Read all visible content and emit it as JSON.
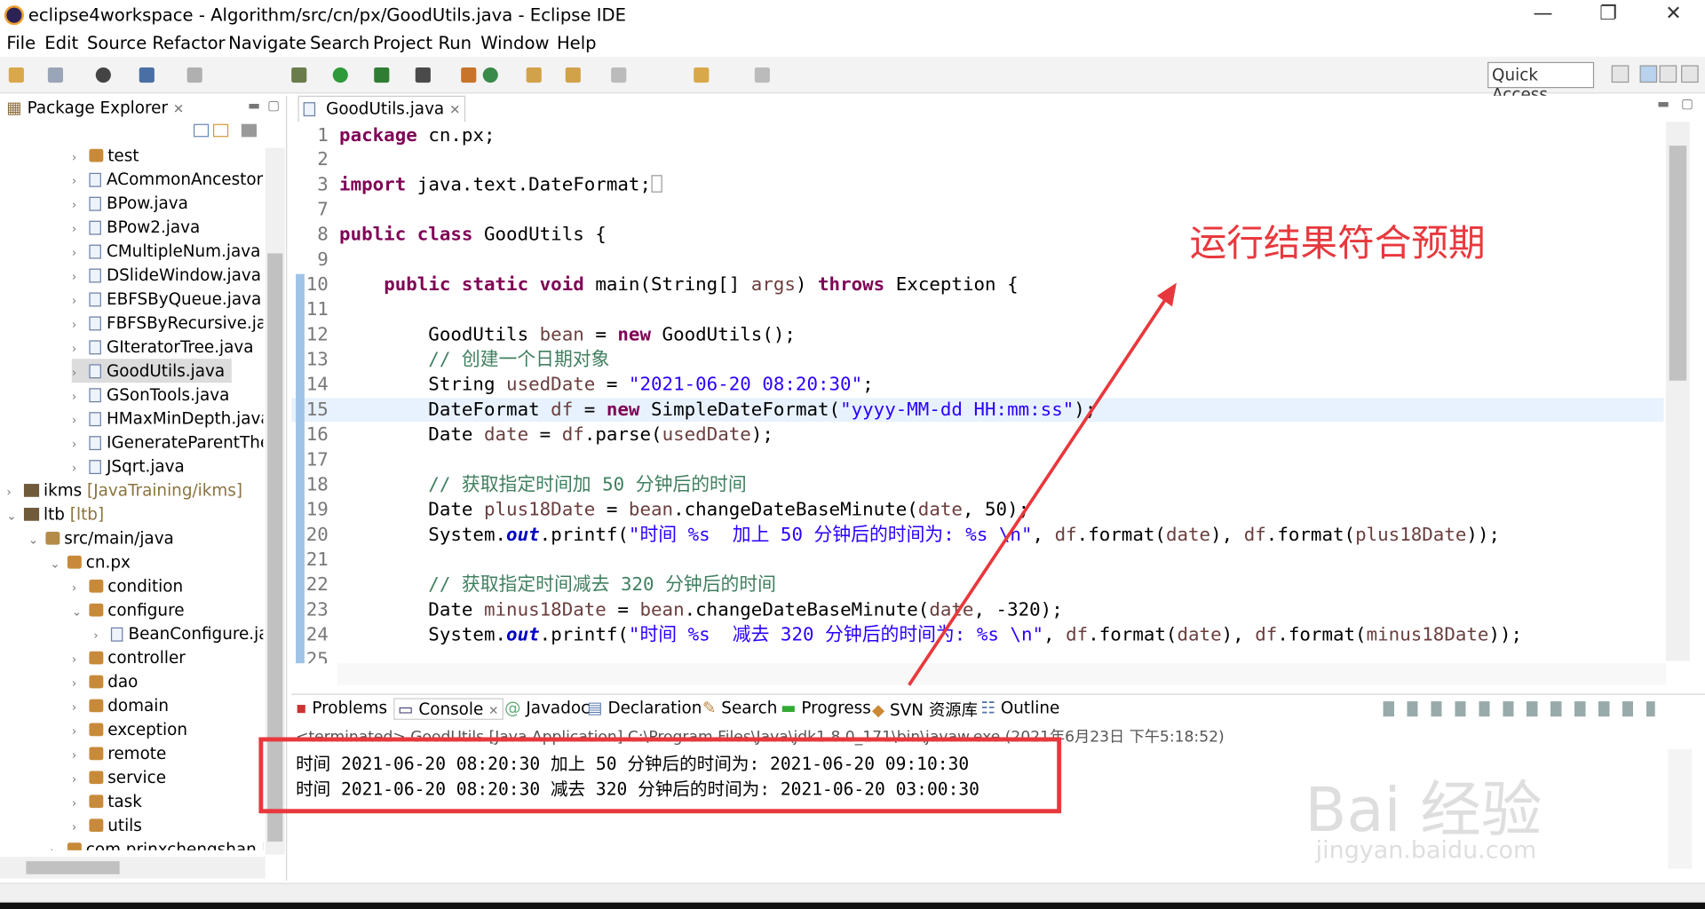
{
  "window": {
    "title": "eclipse4workspace - Algorithm/src/cn/px/GoodUtils.java - Eclipse IDE",
    "minimize": "—",
    "maximize": "❐",
    "close": "✕"
  },
  "menu": [
    "File",
    "Edit",
    "Source",
    "Refactor",
    "Navigate",
    "Search",
    "Project",
    "Run",
    "Window",
    "Help"
  ],
  "toolbar": {
    "quick_access": "Quick Access"
  },
  "explorer": {
    "title": "Package Explorer",
    "items": [
      {
        "label": "test",
        "kind": "pkg"
      },
      {
        "label": "ACommonAncestor.",
        "kind": "java"
      },
      {
        "label": "BPow.java",
        "kind": "java"
      },
      {
        "label": "BPow2.java",
        "kind": "java"
      },
      {
        "label": "CMultipleNum.java",
        "kind": "java"
      },
      {
        "label": "DSlideWindow.java",
        "kind": "java"
      },
      {
        "label": "EBFSByQueue.java",
        "kind": "java"
      },
      {
        "label": "FBFSByRecursive.jav",
        "kind": "java"
      },
      {
        "label": "GIteratorTree.java",
        "kind": "java"
      },
      {
        "label": "GoodUtils.java",
        "kind": "java"
      },
      {
        "label": "GSonTools.java",
        "kind": "java"
      },
      {
        "label": "HMaxMinDepth.java",
        "kind": "java"
      },
      {
        "label": "IGenerateParentThe",
        "kind": "java"
      },
      {
        "label": "JSqrt.java",
        "kind": "java"
      },
      {
        "label": "ikms",
        "suffix": "[JavaTraining/ikms]",
        "kind": "proj"
      },
      {
        "label": "ltb",
        "suffix": "[ltb]",
        "kind": "proj"
      },
      {
        "label": "src/main/java",
        "kind": "src"
      },
      {
        "label": "cn.px",
        "kind": "pkg"
      },
      {
        "label": "condition",
        "kind": "pkg"
      },
      {
        "label": "configure",
        "kind": "pkg"
      },
      {
        "label": "BeanConfigure.jav",
        "kind": "java"
      },
      {
        "label": "controller",
        "kind": "pkg"
      },
      {
        "label": "dao",
        "kind": "pkg"
      },
      {
        "label": "domain",
        "kind": "pkg"
      },
      {
        "label": "exception",
        "kind": "pkg"
      },
      {
        "label": "remote",
        "kind": "pkg"
      },
      {
        "label": "service",
        "kind": "pkg"
      },
      {
        "label": "task",
        "kind": "pkg"
      },
      {
        "label": "utils",
        "kind": "pkg"
      },
      {
        "label": "com.prinxchengshan.lt",
        "kind": "pkg"
      }
    ]
  },
  "editor": {
    "tab": "GoodUtils.java",
    "lines": [
      {
        "n": "1",
        "t": "package cn.px;"
      },
      {
        "n": "2",
        "t": ""
      },
      {
        "n": "3",
        "t": "import java.text.DateFormat;"
      },
      {
        "n": "7",
        "t": ""
      },
      {
        "n": "8",
        "t": "public class GoodUtils {"
      },
      {
        "n": "9",
        "t": ""
      },
      {
        "n": "10",
        "t": "    public static void main(String[] args) throws Exception {"
      },
      {
        "n": "11",
        "t": ""
      },
      {
        "n": "12",
        "t": "        GoodUtils bean = new GoodUtils();"
      },
      {
        "n": "13",
        "t": "        // 创建一个日期对象"
      },
      {
        "n": "14",
        "t": "        String usedDate = \"2021-06-20 08:20:30\";"
      },
      {
        "n": "15",
        "t": "        DateFormat df = new SimpleDateFormat(\"yyyy-MM-dd HH:mm:ss\");"
      },
      {
        "n": "16",
        "t": "        Date date = df.parse(usedDate);"
      },
      {
        "n": "17",
        "t": ""
      },
      {
        "n": "18",
        "t": "        // 获取指定时间加 50 分钟后的时间"
      },
      {
        "n": "19",
        "t": "        Date plus18Date = bean.changeDateBaseMinute(date, 50);"
      },
      {
        "n": "20",
        "t": "        System.out.printf(\"时间 %s  加上 50 分钟后的时间为: %s \\n\", df.format(date), df.format(plus18Date));"
      },
      {
        "n": "21",
        "t": ""
      },
      {
        "n": "22",
        "t": "        // 获取指定时间减去 320 分钟后的时间"
      },
      {
        "n": "23",
        "t": "        Date minus18Date = bean.changeDateBaseMinute(date, -320);"
      },
      {
        "n": "24",
        "t": "        System.out.printf(\"时间 %s  减去 320 分钟后的时间为: %s \\n\", df.format(date), df.format(minus18Date));"
      },
      {
        "n": "25",
        "t": ""
      }
    ]
  },
  "console": {
    "tabs": [
      "Problems",
      "Console",
      "Javadoc",
      "Declaration",
      "Search",
      "Progress",
      "SVN 资源库",
      "Outline"
    ],
    "header": "<terminated> GoodUtils [Java Application] C:\\Program Files\\Java\\jdk1.8.0_171\\bin\\javaw.exe (2021年6月23日 下午5:18:52)",
    "output": [
      "时间 2021-06-20 08:20:30 加上 50 分钟后的时间为: 2021-06-20 09:10:30",
      "时间 2021-06-20 08:20:30 减去 320 分钟后的时间为: 2021-06-20 03:00:30"
    ]
  },
  "annotation": {
    "text": "运行结果符合预期",
    "color": "#e8383d"
  },
  "watermark": {
    "main": "Bai 经验",
    "sub": "jingyan.baidu.com"
  }
}
